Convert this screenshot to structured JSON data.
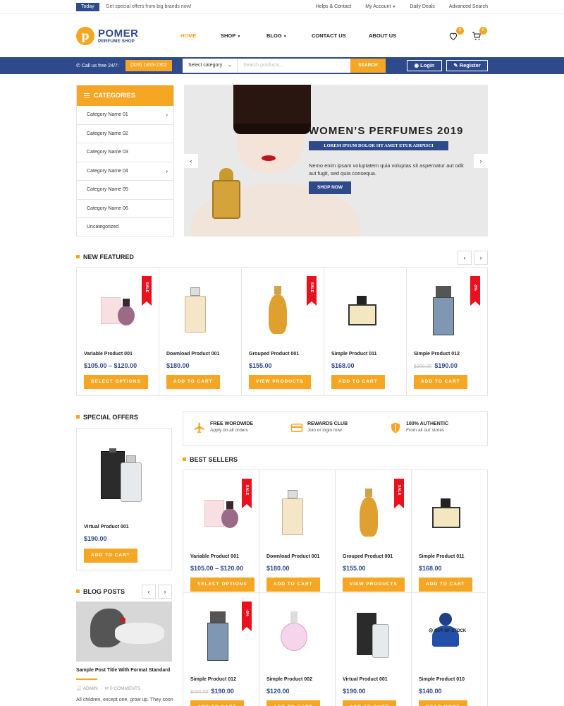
{
  "topbar": {
    "today_label": "Today",
    "promo_text": "Get special offers from big brands now!",
    "links": [
      "Helps & Contact",
      "My Account",
      "Daily Deals",
      "Advanced Search"
    ]
  },
  "brand": {
    "logo_letter": "p",
    "name": "POMER",
    "tagline": "PERFUME SHOP"
  },
  "nav": {
    "items": [
      "HOME",
      "SHOP",
      "BLOG",
      "CONTACT US",
      "ABOUT US"
    ],
    "active": "HOME"
  },
  "header_icons": {
    "wishlist_count": "0",
    "cart_count": "0"
  },
  "searchbar": {
    "call_label": "Call us free 24/7:",
    "phone": "(329) 1833-2302",
    "category_select": "Select category",
    "search_placeholder": "Search products...",
    "search_button": "SEARCH",
    "login_label": "Login",
    "register_label": "Register"
  },
  "categories": {
    "title": "CATEGORIES",
    "items": [
      {
        "label": "Category Name 01",
        "has_children": true
      },
      {
        "label": "Category Name 02",
        "has_children": false
      },
      {
        "label": "Category Name 03",
        "has_children": false
      },
      {
        "label": "Category Name 04",
        "has_children": true
      },
      {
        "label": "Category Name 05",
        "has_children": false
      },
      {
        "label": "Category Name 06",
        "has_children": false
      },
      {
        "label": "Uncategorized",
        "has_children": false
      }
    ]
  },
  "slider": {
    "title": "WOMEN’S PERFUMES 2019",
    "subtitle": "LOREM IPSUM DOLOR SIT AMET ETUR ADIPISCI",
    "description": "Nemo enim ipsam voluptatem quia voluptas sit aspernatur aut odit aut fugit, sed quia consequa.",
    "button": "SHOP NOW",
    "prev": "‹",
    "next": "›"
  },
  "new_featured": {
    "title": "NEW FEATURED",
    "products": [
      {
        "name": "Variable Product 001",
        "price": "$105.00 – $120.00",
        "old_price": "",
        "button": "SELECT OPTIONS",
        "ribbon": "SALE"
      },
      {
        "name": "Download Product 001",
        "price": "$180.00",
        "old_price": "",
        "button": "ADD TO CART",
        "ribbon": ""
      },
      {
        "name": "Grouped Product 001",
        "price": "$155.00",
        "old_price": "",
        "button": "VIEW PRODUCTS",
        "ribbon": "SALE"
      },
      {
        "name": "Simple Product 011",
        "price": "$168.00",
        "old_price": "",
        "button": "ADD TO CART",
        "ribbon": ""
      },
      {
        "name": "Simple Product 012",
        "price": "$190.00",
        "old_price": "$200.00",
        "button": "ADD TO CART",
        "ribbon": "-5%"
      }
    ]
  },
  "features": [
    {
      "title": "FREE WORDWIDE",
      "desc": "Apply on all orders",
      "icon": "plane-icon"
    },
    {
      "title": "REWARDS CLUB",
      "desc": "Join or login now",
      "icon": "card-icon"
    },
    {
      "title": "100% AUTHENTIC",
      "desc": "From all our stores",
      "icon": "shield-icon"
    }
  ],
  "special_offers": {
    "title": "SPECIAL OFFERS",
    "product": {
      "name": "Virtual Product 001",
      "price": "$190.00",
      "button": "ADD TO CART"
    }
  },
  "best_sellers": {
    "title": "BEST SELLERS",
    "products": [
      {
        "name": "Variable Product 001",
        "price": "$105.00 – $120.00",
        "old_price": "",
        "button": "SELECT OPTIONS",
        "ribbon": "SALE"
      },
      {
        "name": "Download Product 001",
        "price": "$180.00",
        "old_price": "",
        "button": "ADD TO CART",
        "ribbon": ""
      },
      {
        "name": "Grouped Product 001",
        "price": "$155.00",
        "old_price": "",
        "button": "VIEW PRODUCTS",
        "ribbon": "SALE"
      },
      {
        "name": "Simple Product 011",
        "price": "$168.00",
        "old_price": "",
        "button": "ADD TO CART",
        "ribbon": ""
      },
      {
        "name": "Simple Product 012",
        "price": "$190.00",
        "old_price": "$200.00",
        "button": "ADD TO CART",
        "ribbon": "-5%"
      },
      {
        "name": "Simple Product 002",
        "price": "$120.00",
        "old_price": "",
        "button": "ADD TO CART",
        "ribbon": ""
      },
      {
        "name": "Virtual Product 001",
        "price": "$190.00",
        "old_price": "",
        "button": "ADD TO CART",
        "ribbon": ""
      },
      {
        "name": "Simple Product 010",
        "price": "$140.00",
        "old_price": "",
        "button": "READ MORE",
        "ribbon": "",
        "status": "OUT OF STOCK"
      }
    ]
  },
  "blog": {
    "title": "BLOG POSTS",
    "post_title": "Sample Post Title With Format Standard",
    "author": "ADMIN",
    "comments": "0 COMMENTS",
    "excerpt": "All children, except one, grow up. They soon"
  },
  "colors": {
    "primary": "#2f4a8b",
    "accent": "#f5a623",
    "sale": "#e8111d"
  }
}
